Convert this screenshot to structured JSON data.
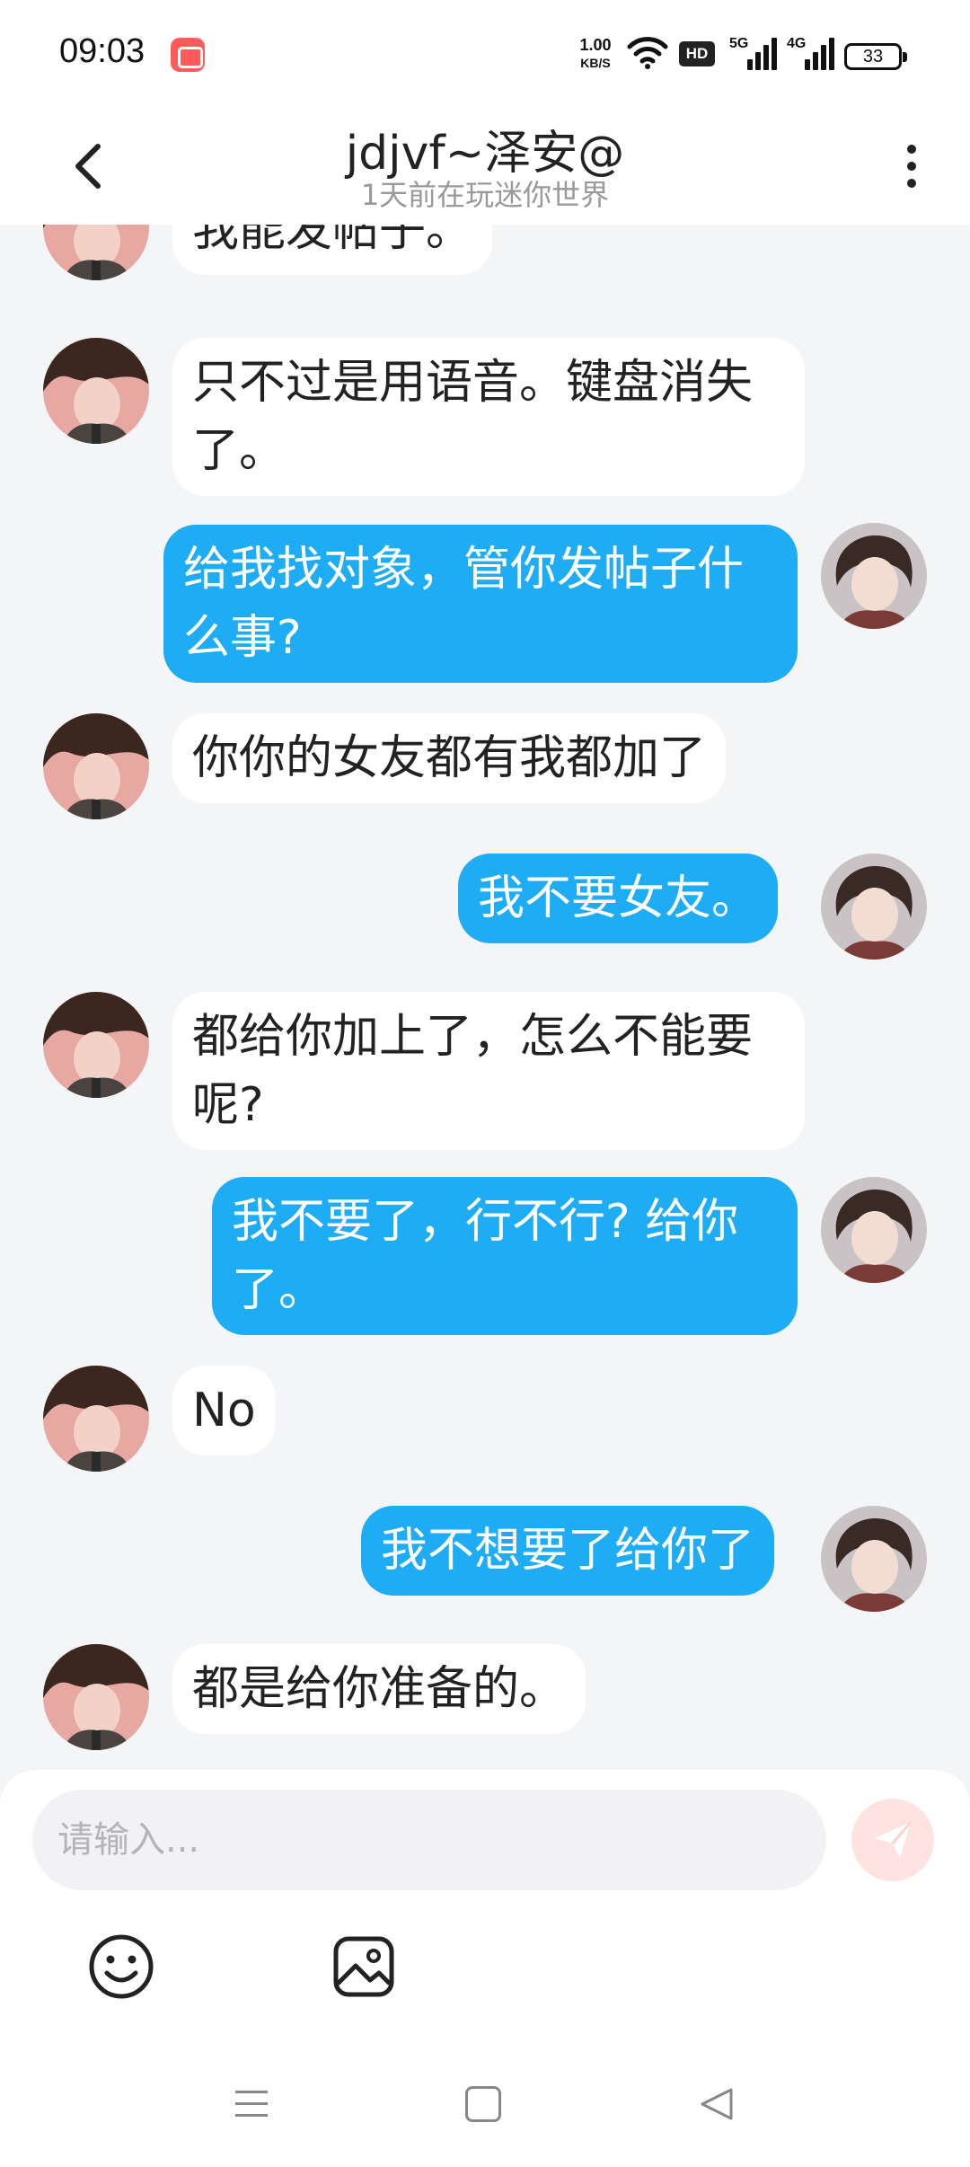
{
  "status_bar": {
    "time": "09:03",
    "net_speed_value": "1.00",
    "net_speed_unit": "KB/S",
    "hd_label": "HD",
    "signal_5g_label": "5G",
    "signal_4g_label": "4G",
    "battery_level": "33"
  },
  "header": {
    "title": "jdjvf~泽安@",
    "subtitle": "1天前在玩迷你世界"
  },
  "messages": [
    {
      "side": "in",
      "text": "我能发帖子。"
    },
    {
      "side": "in",
      "text": "只不过是用语音。键盘消失了。"
    },
    {
      "side": "out",
      "text": "给我找对象，管你发帖子什么事?"
    },
    {
      "side": "in",
      "text": "你你的女友都有我都加了"
    },
    {
      "side": "out",
      "text": "我不要女友。"
    },
    {
      "side": "in",
      "text": "都给你加上了，怎么不能要呢?"
    },
    {
      "side": "out",
      "text": "我不要了，行不行? 给你了。"
    },
    {
      "side": "in",
      "text": "No"
    },
    {
      "side": "out",
      "text": "我不想要了给你了"
    },
    {
      "side": "in",
      "text": "都是给你准备的。"
    }
  ],
  "input": {
    "placeholder": "请输入..."
  },
  "icons": {
    "back": "chevron-left-icon",
    "more": "more-vertical-icon",
    "send": "paper-plane-icon",
    "emoji": "smiley-icon",
    "image": "image-icon"
  },
  "colors": {
    "outgoing_bubble": "#1eadf5",
    "incoming_bubble": "#ffffff",
    "send_button_bg": "#ffe3e0",
    "background": "#f4f5f7"
  }
}
